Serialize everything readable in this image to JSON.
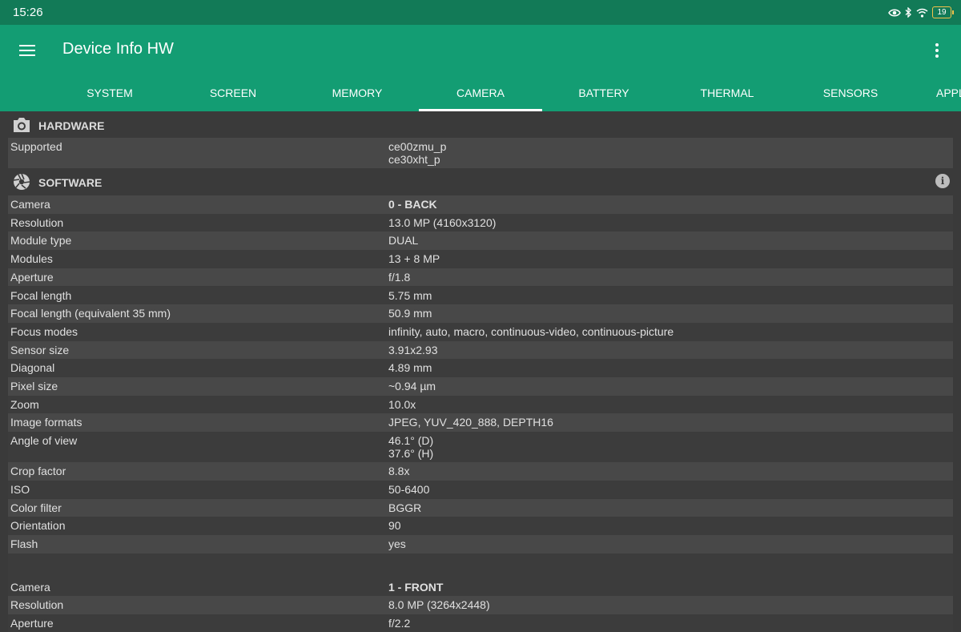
{
  "status": {
    "time": "15:26",
    "battery": "19"
  },
  "appbar": {
    "title": "Device Info HW"
  },
  "tabs": [
    "SYSTEM",
    "SCREEN",
    "MEMORY",
    "CAMERA",
    "BATTERY",
    "THERMAL",
    "SENSORS",
    "APPL"
  ],
  "active_tab": "CAMERA",
  "hardware": {
    "title": "HARDWARE",
    "supported_label": "Supported",
    "supported_values": [
      "ce00zmu_p",
      "ce30xht_p"
    ]
  },
  "software": {
    "title": "SOFTWARE",
    "rows": [
      {
        "k": "Camera",
        "v": "0 - BACK"
      },
      {
        "k": "Resolution",
        "v": "13.0 MP (4160x3120)"
      },
      {
        "k": "Module type",
        "v": "DUAL"
      },
      {
        "k": "Modules",
        "v": "13 + 8 MP"
      },
      {
        "k": "Aperture",
        "v": "f/1.8"
      },
      {
        "k": "Focal length",
        "v": "5.75 mm"
      },
      {
        "k": "Focal length (equivalent 35 mm)",
        "v": "50.9 mm"
      },
      {
        "k": "Focus modes",
        "v": "infinity, auto, macro, continuous-video, continuous-picture"
      },
      {
        "k": "Sensor size",
        "v": "3.91x2.93"
      },
      {
        "k": "Diagonal",
        "v": "4.89 mm"
      },
      {
        "k": "Pixel size",
        "v": "~0.94 µm"
      },
      {
        "k": "Zoom",
        "v": "10.0x"
      },
      {
        "k": "Image formats",
        "v": "JPEG, YUV_420_888, DEPTH16"
      },
      {
        "k": "Angle of view",
        "v": "46.1° (D)",
        "v2": "37.6° (H)"
      },
      {
        "k": "Crop factor",
        "v": "8.8x"
      },
      {
        "k": "ISO",
        "v": "50-6400"
      },
      {
        "k": "Color filter",
        "v": "BGGR"
      },
      {
        "k": "Orientation",
        "v": "90"
      },
      {
        "k": "Flash",
        "v": "yes"
      }
    ],
    "front_rows": [
      {
        "k": "Camera",
        "v": "1 - FRONT"
      },
      {
        "k": "Resolution",
        "v": "8.0 MP (3264x2448)"
      },
      {
        "k": "Aperture",
        "v": "f/2.2"
      }
    ]
  }
}
